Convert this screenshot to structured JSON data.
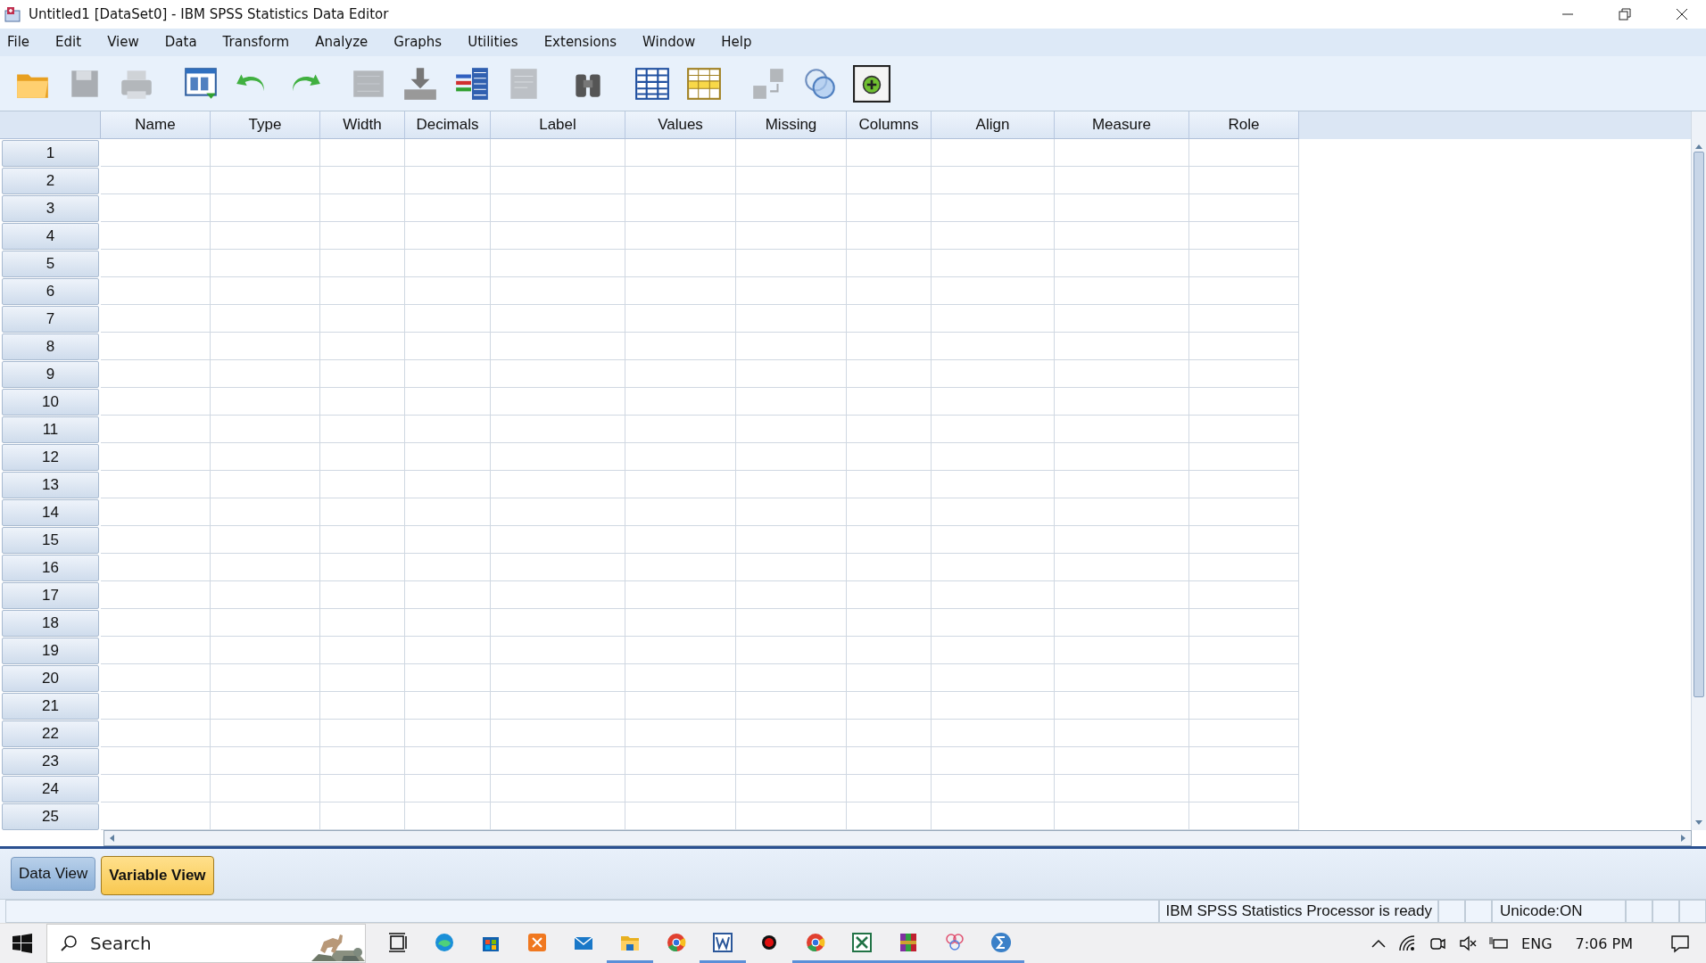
{
  "window": {
    "title": "Untitled1 [DataSet0] - IBM SPSS Statistics Data Editor"
  },
  "menu": [
    "File",
    "Edit",
    "View",
    "Data",
    "Transform",
    "Analyze",
    "Graphs",
    "Utilities",
    "Extensions",
    "Window",
    "Help"
  ],
  "toolbar": [
    {
      "kind": "open",
      "disabled": false
    },
    {
      "kind": "save",
      "disabled": true
    },
    {
      "kind": "print",
      "disabled": true
    },
    {
      "kind": "dialog",
      "disabled": false
    },
    {
      "kind": "undo",
      "disabled": false
    },
    {
      "kind": "redo",
      "disabled": false
    },
    {
      "kind": "gotocase",
      "disabled": true
    },
    {
      "kind": "gotovar",
      "disabled": false
    },
    {
      "kind": "variables",
      "disabled": false
    },
    {
      "kind": "doc",
      "disabled": true
    },
    {
      "kind": "find",
      "disabled": false
    },
    {
      "kind": "insertcases",
      "disabled": false
    },
    {
      "kind": "insertvar",
      "disabled": false
    },
    {
      "kind": "split",
      "disabled": true
    },
    {
      "kind": "circles",
      "disabled": false
    },
    {
      "kind": "plus",
      "disabled": false
    }
  ],
  "table": {
    "columns": [
      "Name",
      "Type",
      "Width",
      "Decimals",
      "Label",
      "Values",
      "Missing",
      "Columns",
      "Align",
      "Measure",
      "Role"
    ],
    "rows": [
      "1",
      "2",
      "3",
      "4",
      "5",
      "6",
      "7",
      "8",
      "9",
      "10",
      "11",
      "12",
      "13",
      "14",
      "15",
      "16",
      "17",
      "18",
      "19",
      "20",
      "21",
      "22",
      "23",
      "24",
      "25"
    ]
  },
  "tabs": [
    {
      "label": "Data View",
      "selected": false
    },
    {
      "label": "Variable View",
      "selected": true
    }
  ],
  "status_bar": {
    "message": "IBM SPSS Statistics Processor is ready",
    "encoding": "Unicode:ON"
  },
  "taskbar": {
    "search": {
      "placeholder": "Search"
    },
    "apps": [
      {
        "kind": "taskview",
        "running": false
      },
      {
        "kind": "edge",
        "running": false
      },
      {
        "kind": "store",
        "running": false
      },
      {
        "kind": "xampp",
        "running": false
      },
      {
        "kind": "mail",
        "running": false
      },
      {
        "kind": "folder",
        "running": true
      },
      {
        "kind": "chrome",
        "running": false
      },
      {
        "kind": "word",
        "running": true
      },
      {
        "kind": "record",
        "running": false
      },
      {
        "kind": "chrome",
        "running": true
      },
      {
        "kind": "excel",
        "running": true
      },
      {
        "kind": "winrar",
        "running": true
      },
      {
        "kind": "flower",
        "running": true
      },
      {
        "kind": "sigma",
        "running": true
      }
    ],
    "language": "ENG",
    "time": "7:06 PM"
  }
}
